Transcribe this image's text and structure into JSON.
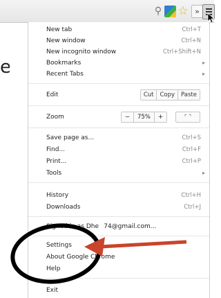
{
  "left_fragment": "e",
  "toolbar": {
    "icons": [
      "magnifier-icon",
      "page-icon",
      "star-icon",
      "chevron-icon",
      "menu-icon"
    ],
    "chevron": "»"
  },
  "menu": {
    "new_tab": {
      "label": "New tab",
      "shortcut": "Ctrl+T"
    },
    "new_window": {
      "label": "New window",
      "shortcut": "Ctrl+N"
    },
    "new_incognito": {
      "label": "New incognito window",
      "shortcut": "Ctrl+Shift+N"
    },
    "bookmarks": {
      "label": "Bookmarks"
    },
    "recent_tabs": {
      "label": "Recent Tabs"
    },
    "edit": {
      "label": "Edit",
      "cut": "Cut",
      "copy": "Copy",
      "paste": "Paste"
    },
    "zoom": {
      "label": "Zoom",
      "minus": "−",
      "level": "75%",
      "plus": "+"
    },
    "save_page": {
      "label": "Save page as...",
      "shortcut": "Ctrl+S"
    },
    "find": {
      "label": "Find...",
      "shortcut": "Ctrl+F"
    },
    "print": {
      "label": "Print...",
      "shortcut": "Ctrl+P"
    },
    "tools": {
      "label": "Tools"
    },
    "history": {
      "label": "History",
      "shortcut": "Ctrl+H"
    },
    "downloads": {
      "label": "Downloads",
      "shortcut": "Ctrl+J"
    },
    "signed_in": {
      "label": "Signed in as Dhe    74@gmail.com..."
    },
    "settings": {
      "label": "Settings"
    },
    "about": {
      "label": "About Google Chrome"
    },
    "help": {
      "label": "Help"
    },
    "exit": {
      "label": "Exit"
    }
  },
  "colors": {
    "annotation_arrow": "#c9442a",
    "annotation_circle": "#000000"
  }
}
